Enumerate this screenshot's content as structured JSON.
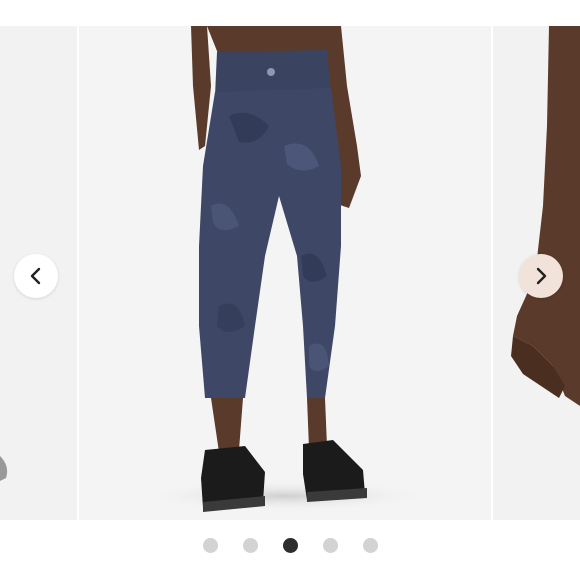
{
  "carousel": {
    "slides": [
      {
        "id": "prev",
        "depicts": "partial-product-image"
      },
      {
        "id": "current",
        "depicts": "leggings-back-view"
      },
      {
        "id": "next",
        "depicts": "partial-arm-image"
      }
    ],
    "prev_icon": "chevron-left-icon",
    "next_icon": "chevron-right-icon",
    "dot_count": 5,
    "active_index": 2
  },
  "colors": {
    "legging": "#3e4866",
    "legging_dark": "#2c3550",
    "skin": "#5a3a2a",
    "shoe": "#1b1b1b",
    "dot_inactive": "#d3d3d3",
    "dot_active": "#2d2d2d",
    "next_button_bg": "#f2e3da"
  }
}
